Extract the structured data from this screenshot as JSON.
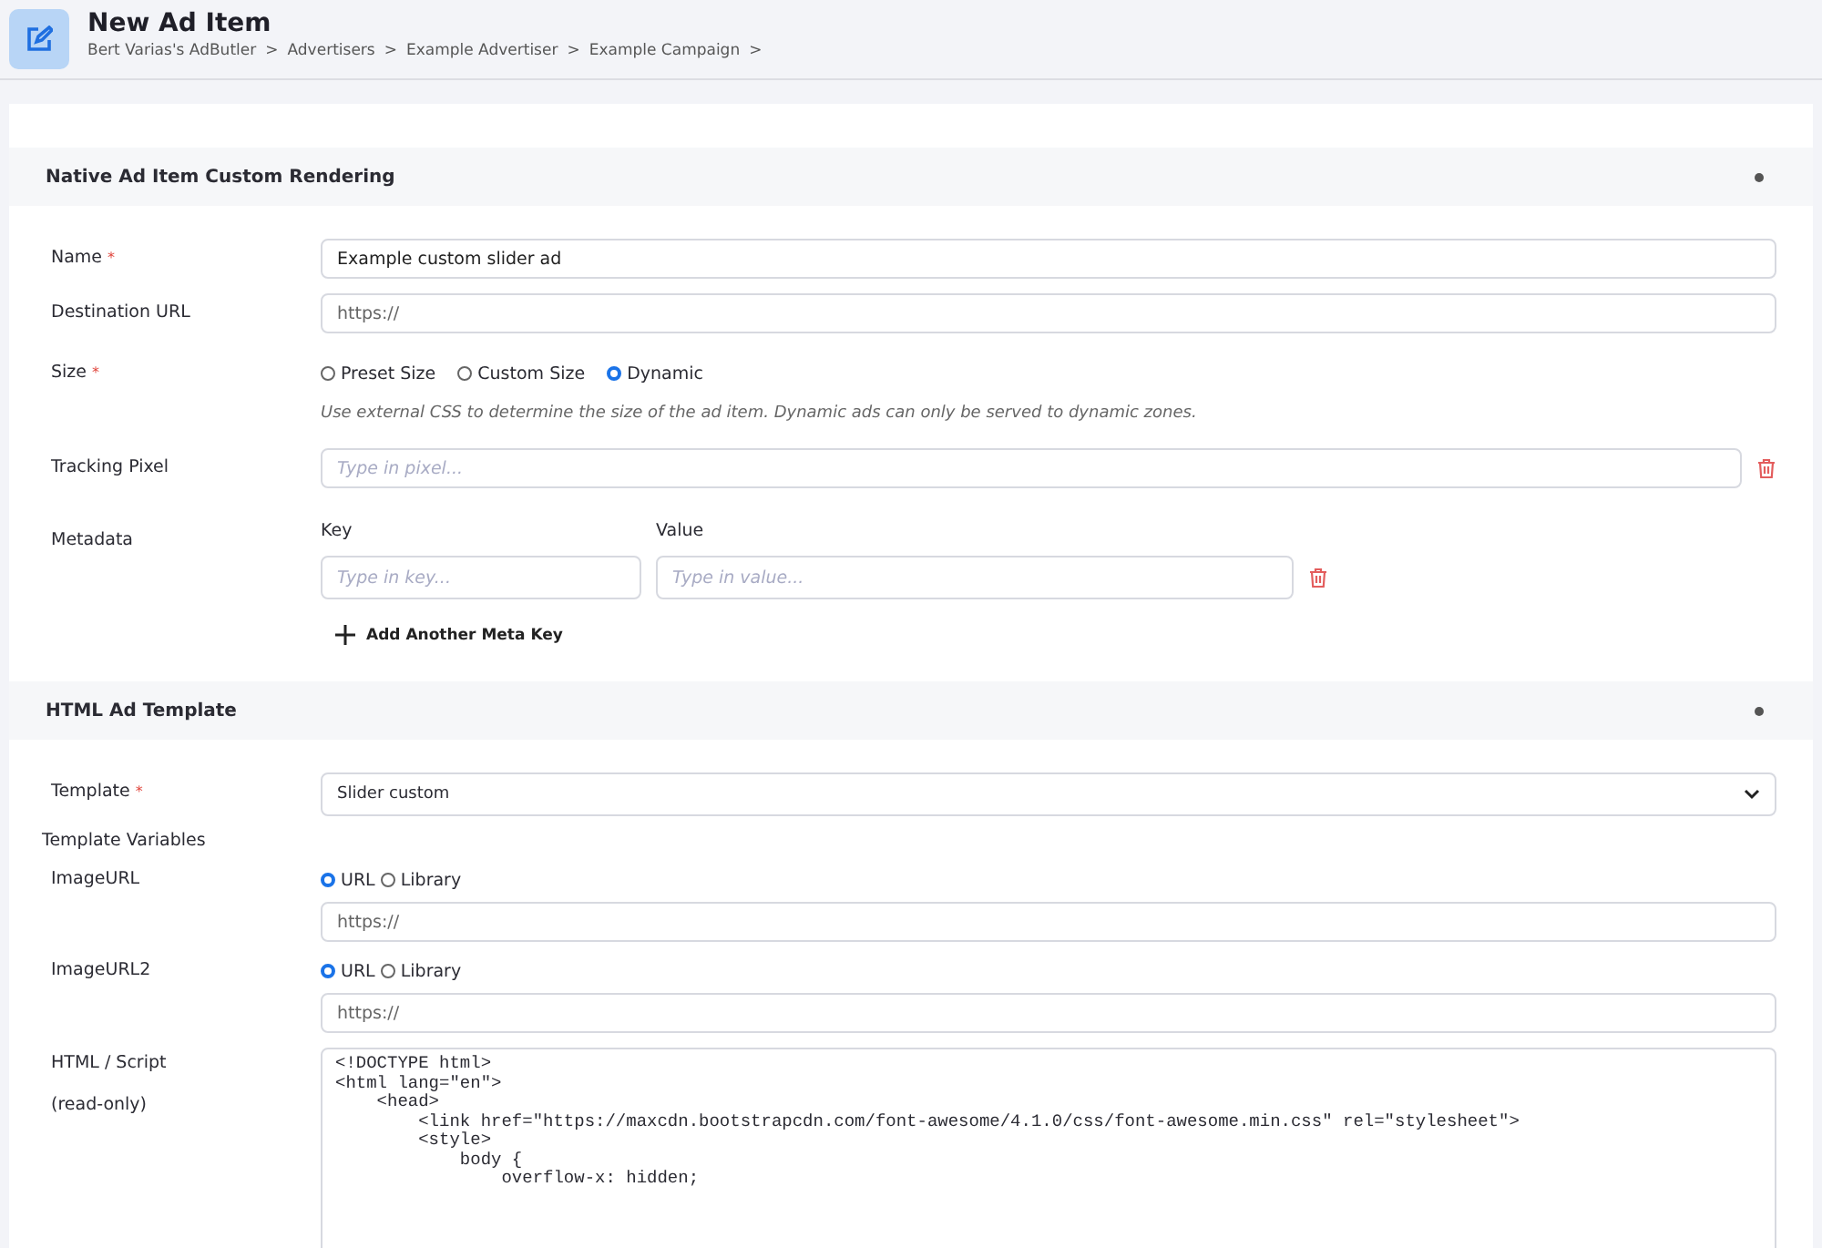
{
  "header": {
    "title": "New Ad Item",
    "breadcrumb": [
      "Bert Varias's AdButler",
      "Advertisers",
      "Example Advertiser",
      "Example Campaign"
    ],
    "separator": ">"
  },
  "sections": [
    {
      "title": "Native Ad Item Custom Rendering",
      "fields": [
        {
          "kind": "text",
          "label": "Name",
          "required_mark": "*",
          "value": "Example custom slider ad"
        },
        {
          "kind": "text",
          "label": "Destination URL",
          "placeholder": "https://"
        },
        {
          "kind": "radio",
          "label": "Size",
          "required_mark": "*",
          "options": [
            {
              "label": "Preset Size",
              "selected": false
            },
            {
              "label": "Custom Size",
              "selected": false
            },
            {
              "label": "Dynamic",
              "selected": true
            }
          ],
          "hint": "Use external CSS to determine the size of the ad item. Dynamic ads can only be served to dynamic zones."
        },
        {
          "kind": "removable",
          "label": "Tracking Pixel",
          "placeholder": "Type in pixel..."
        },
        {
          "kind": "metadata",
          "label": "Metadata",
          "key_heading": "Key",
          "value_heading": "Value",
          "key_placeholder": "Type in key...",
          "value_placeholder": "Type in value...",
          "add_label": "Add Another Meta Key"
        }
      ]
    },
    {
      "title": "HTML Ad Template",
      "fields": [
        {
          "kind": "select",
          "label": "Template",
          "required_mark": "*",
          "value": "Slider custom"
        },
        {
          "kind": "heading",
          "label": "Template Variables"
        },
        {
          "kind": "source",
          "label": "ImageURL",
          "options": [
            {
              "label": "URL",
              "selected": true
            },
            {
              "label": "Library",
              "selected": false
            }
          ],
          "placeholder": "https://"
        },
        {
          "kind": "source",
          "label": "ImageURL2",
          "options": [
            {
              "label": "URL",
              "selected": true
            },
            {
              "label": "Library",
              "selected": false
            }
          ],
          "placeholder": "https://"
        },
        {
          "kind": "code",
          "label": "HTML / Script",
          "sublabel": "(read-only)",
          "lines": [
            "<!DOCTYPE html>",
            "<html lang=\"en\">",
            "    <head>",
            "        <link href=\"https://maxcdn.bootstrapcdn.com/font-awesome/4.1.0/css/font-awesome.min.css\" rel=\"stylesheet\">",
            "        <style>",
            "            body {",
            "                overflow-x: hidden;"
          ]
        }
      ]
    }
  ]
}
